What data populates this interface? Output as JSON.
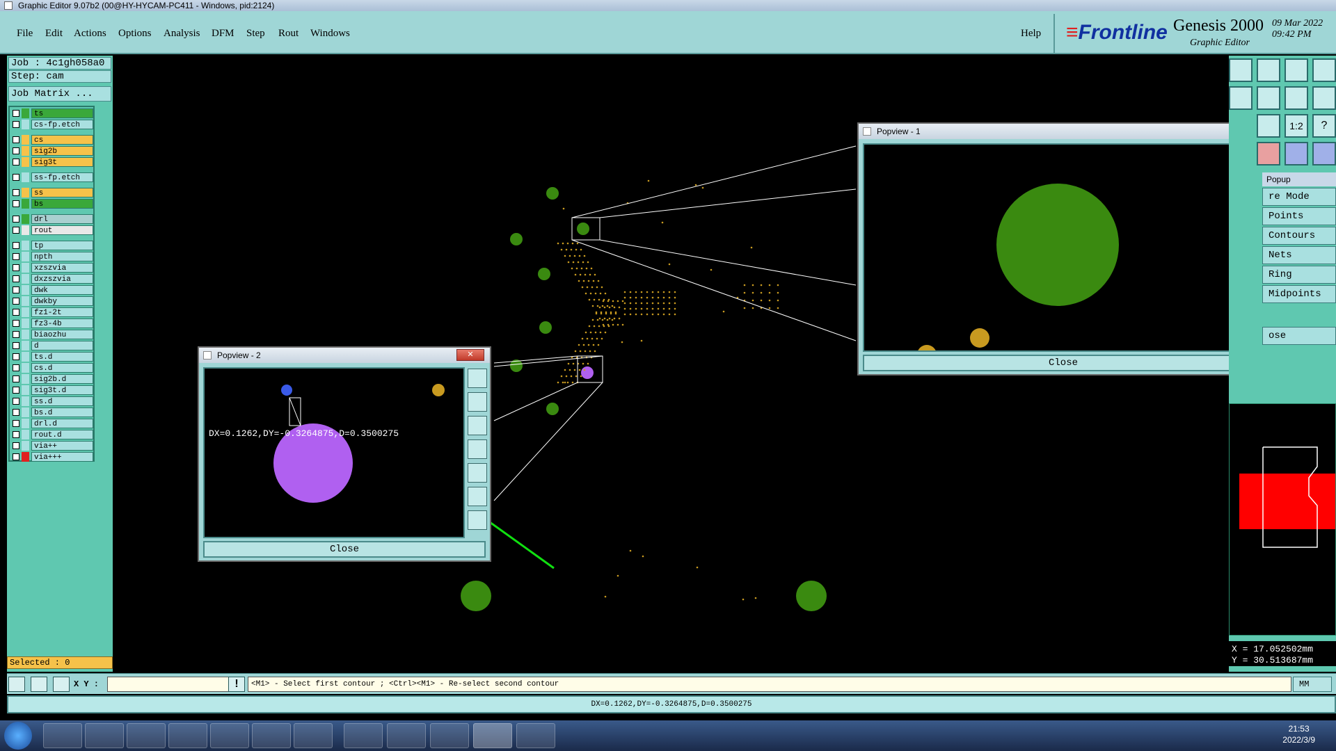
{
  "window": {
    "title": "Graphic Editor 9.07b2 (00@HY-HYCAM-PC411 - Windows, pid:2124)"
  },
  "menu": {
    "items": [
      "File",
      "Edit",
      "Actions",
      "Options",
      "Analysis",
      "DFM",
      "Step",
      "Rout",
      "Windows"
    ],
    "help": "Help"
  },
  "brand": {
    "logo": "Frontline",
    "product": "Genesis 2000",
    "subtitle": "Graphic Editor",
    "date": "09 Mar 2022",
    "time": "09:42 PM"
  },
  "job": {
    "job_label": "Job : 4c1gh058a0",
    "step_label": "Step: cam",
    "matrix_button": "Job Matrix ..."
  },
  "layers": [
    {
      "name": "ts",
      "color": "#3aa83a",
      "text_bg": "#3aa83a"
    },
    {
      "name": "cs-fp.etch",
      "color": "#a9e0e0",
      "text_bg": "#a9e0e0"
    },
    {
      "name": "cs",
      "color": "#f6c24a",
      "text_bg": "#f6c24a"
    },
    {
      "name": "sig2b",
      "color": "#f6c24a",
      "text_bg": "#f6c24a"
    },
    {
      "name": "sig3t",
      "color": "#f6c24a",
      "text_bg": "#f6c24a"
    },
    {
      "name": "ss-fp.etch",
      "color": "#a9e0e0",
      "text_bg": "#a9e0e0"
    },
    {
      "name": "ss",
      "color": "#f6c24a",
      "text_bg": "#f6c24a"
    },
    {
      "name": "bs",
      "color": "#3aa83a",
      "text_bg": "#3aa83a"
    },
    {
      "name": "drl",
      "color": "#3aa83a",
      "text_bg": "#a9d0d0"
    },
    {
      "name": "rout",
      "color": "#e8e8e8",
      "text_bg": "#e8e8e8"
    },
    {
      "name": "tp",
      "color": "#a9e0e0",
      "text_bg": "#a9e0e0"
    },
    {
      "name": "npth",
      "color": "#a9e0e0",
      "text_bg": "#a9e0e0"
    },
    {
      "name": "xzszvia",
      "color": "#a9e0e0",
      "text_bg": "#a9e0e0"
    },
    {
      "name": "dxzszvia",
      "color": "#a9e0e0",
      "text_bg": "#a9e0e0"
    },
    {
      "name": "dwk",
      "color": "#a9e0e0",
      "text_bg": "#a9e0e0"
    },
    {
      "name": "dwkby",
      "color": "#a9e0e0",
      "text_bg": "#a9e0e0"
    },
    {
      "name": "fz1-2t",
      "color": "#a9e0e0",
      "text_bg": "#a9e0e0"
    },
    {
      "name": "fz3-4b",
      "color": "#a9e0e0",
      "text_bg": "#a9e0e0"
    },
    {
      "name": "biaozhu",
      "color": "#a9e0e0",
      "text_bg": "#a9e0e0"
    },
    {
      "name": "d",
      "color": "#a9e0e0",
      "text_bg": "#a9e0e0"
    },
    {
      "name": "ts.d",
      "color": "#a9e0e0",
      "text_bg": "#a9e0e0"
    },
    {
      "name": "cs.d",
      "color": "#a9e0e0",
      "text_bg": "#a9e0e0"
    },
    {
      "name": "sig2b.d",
      "color": "#a9e0e0",
      "text_bg": "#a9e0e0"
    },
    {
      "name": "sig3t.d",
      "color": "#a9e0e0",
      "text_bg": "#a9e0e0"
    },
    {
      "name": "ss.d",
      "color": "#a9e0e0",
      "text_bg": "#a9e0e0"
    },
    {
      "name": "bs.d",
      "color": "#a9e0e0",
      "text_bg": "#a9e0e0"
    },
    {
      "name": "drl.d",
      "color": "#a9e0e0",
      "text_bg": "#a9e0e0"
    },
    {
      "name": "rout.d",
      "color": "#a9e0e0",
      "text_bg": "#a9e0e0"
    },
    {
      "name": "via++",
      "color": "#a9e0e0",
      "text_bg": "#a9e0e0"
    },
    {
      "name": "via+++",
      "color": "#e02020",
      "text_bg": "#a9e0e0"
    }
  ],
  "selected": "Selected : 0",
  "popview1": {
    "title": "Popview - 1",
    "close_label": "Close"
  },
  "popview2": {
    "title": "Popview - 2",
    "close_label": "Close",
    "measurement": "DX=0.1262,DY=-0.3264875,D=0.3500275"
  },
  "right_panel": {
    "popup_title": "Popup",
    "modes": [
      "re Mode",
      "Points",
      "Contours",
      "Nets",
      "Ring",
      "Midpoints"
    ],
    "close_label": "ose",
    "coord_x": "X = 17.052502mm",
    "coord_y": "Y = 30.513687mm"
  },
  "command": {
    "xy_label": "X Y :",
    "xy_value": "",
    "prompt": "<M1> - Select first contour ; <Ctrl><M1> - Re-select second contour",
    "unit": "MM"
  },
  "status": "DX=0.1262,DY=-0.3264875,D=0.3500275",
  "taskbar": {
    "time": "21:53",
    "date": "2022/3/9"
  },
  "colors": {
    "pad_green": "#3a8a10",
    "via_orange": "#c89a20",
    "highlight_purple": "#b060f0",
    "arrow_green": "#10e010",
    "panel_teal": "#9fd6d6"
  }
}
